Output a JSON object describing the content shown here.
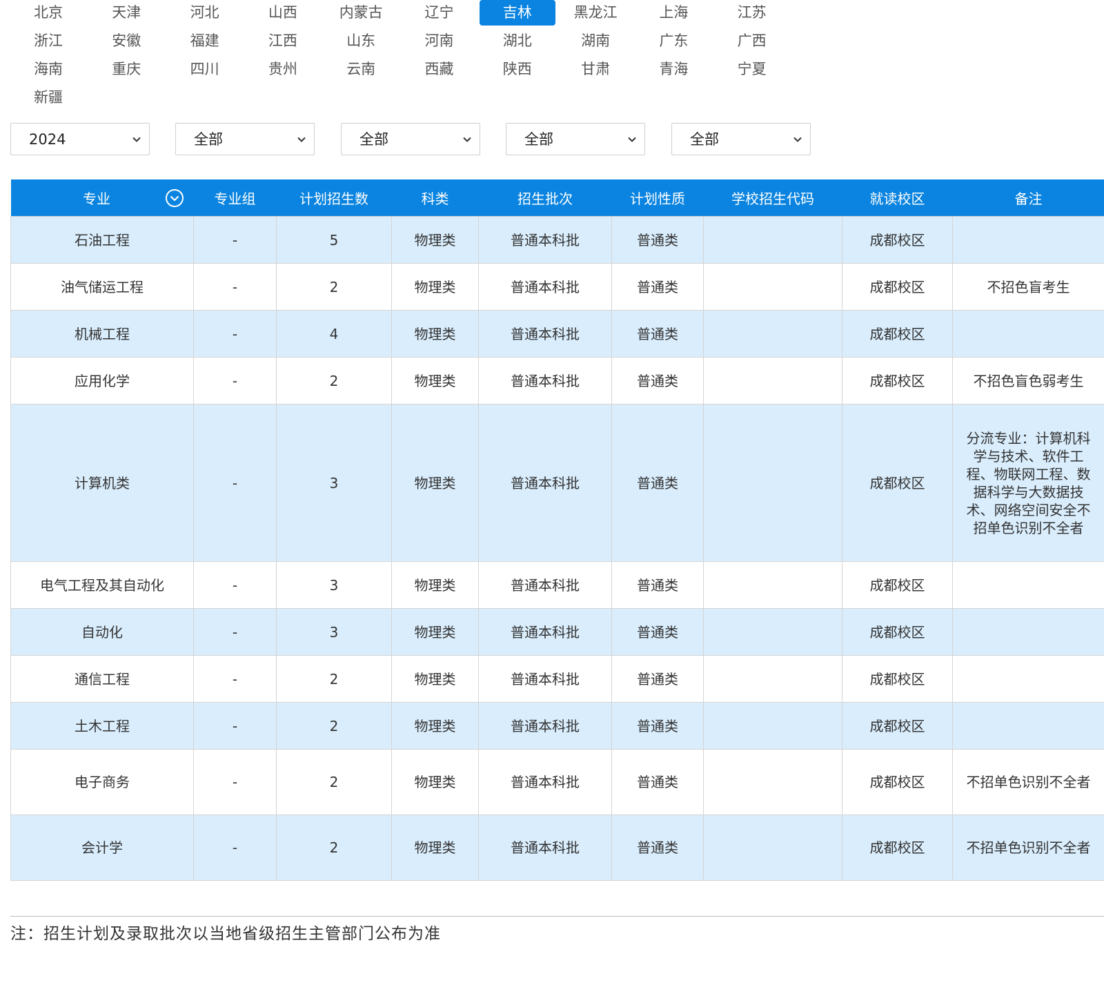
{
  "provinces": {
    "items": [
      "北京",
      "天津",
      "河北",
      "山西",
      "内蒙古",
      "辽宁",
      "吉林",
      "黑龙江",
      "上海",
      "江苏",
      "浙江",
      "安徽",
      "福建",
      "江西",
      "山东",
      "河南",
      "湖北",
      "湖南",
      "广东",
      "广西",
      "海南",
      "重庆",
      "四川",
      "贵州",
      "云南",
      "西藏",
      "陕西",
      "甘肃",
      "青海",
      "宁夏",
      "新疆"
    ],
    "selected": "吉林"
  },
  "filters": {
    "year": "2024",
    "filter2": "全部",
    "filter3": "全部",
    "filter4": "全部",
    "filter5": "全部"
  },
  "table": {
    "headers": [
      "专业",
      "专业组",
      "计划招生数",
      "科类",
      "招生批次",
      "计划性质",
      "学校招生代码",
      "就读校区",
      "备注"
    ],
    "rows": [
      [
        "石油工程",
        "-",
        "5",
        "物理类",
        "普通本科批",
        "普通类",
        "",
        "成都校区",
        ""
      ],
      [
        "油气储运工程",
        "-",
        "2",
        "物理类",
        "普通本科批",
        "普通类",
        "",
        "成都校区",
        "不招色盲考生"
      ],
      [
        "机械工程",
        "-",
        "4",
        "物理类",
        "普通本科批",
        "普通类",
        "",
        "成都校区",
        ""
      ],
      [
        "应用化学",
        "-",
        "2",
        "物理类",
        "普通本科批",
        "普通类",
        "",
        "成都校区",
        "不招色盲色弱考生"
      ],
      [
        "计算机类",
        "-",
        "3",
        "物理类",
        "普通本科批",
        "普通类",
        "",
        "成都校区",
        "分流专业：计算机科学与技术、软件工程、物联网工程、数据科学与大数据技术、网络空间安全不招单色识别不全者"
      ],
      [
        "电气工程及其自动化",
        "-",
        "3",
        "物理类",
        "普通本科批",
        "普通类",
        "",
        "成都校区",
        ""
      ],
      [
        "自动化",
        "-",
        "3",
        "物理类",
        "普通本科批",
        "普通类",
        "",
        "成都校区",
        ""
      ],
      [
        "通信工程",
        "-",
        "2",
        "物理类",
        "普通本科批",
        "普通类",
        "",
        "成都校区",
        ""
      ],
      [
        "土木工程",
        "-",
        "2",
        "物理类",
        "普通本科批",
        "普通类",
        "",
        "成都校区",
        ""
      ],
      [
        "电子商务",
        "-",
        "2",
        "物理类",
        "普通本科批",
        "普通类",
        "",
        "成都校区",
        "不招单色识别不全者"
      ],
      [
        "会计学",
        "-",
        "2",
        "物理类",
        "普通本科批",
        "普通类",
        "",
        "成都校区",
        "不招单色识别不全者"
      ]
    ]
  },
  "footnote": "注：招生计划及录取批次以当地省级招生主管部门公布为准",
  "colors": {
    "accent": "#0a84e0",
    "row_odd": "#d9edfc",
    "row_even": "#ffffff"
  },
  "icons": {
    "sort": "chevron-circle-down-icon",
    "select": "chevron-down-icon"
  }
}
